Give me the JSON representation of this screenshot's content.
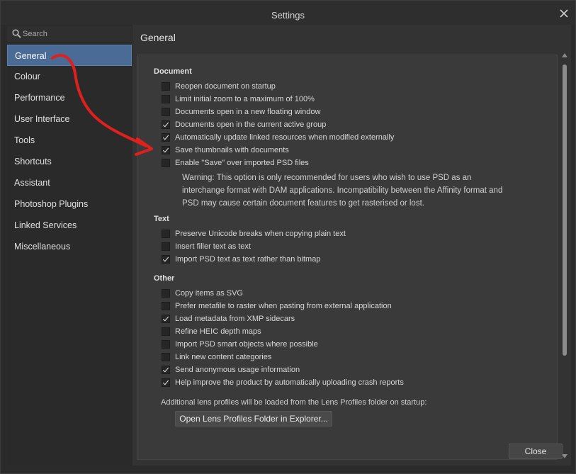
{
  "window": {
    "title": "Settings",
    "close_icon": "close-icon"
  },
  "sidebar": {
    "search_placeholder": "Search",
    "items": [
      {
        "label": "General",
        "active": true
      },
      {
        "label": "Colour"
      },
      {
        "label": "Performance"
      },
      {
        "label": "User Interface"
      },
      {
        "label": "Tools"
      },
      {
        "label": "Shortcuts"
      },
      {
        "label": "Assistant"
      },
      {
        "label": "Photoshop Plugins"
      },
      {
        "label": "Linked Services"
      },
      {
        "label": "Miscellaneous"
      }
    ]
  },
  "main": {
    "header": "General",
    "sections": {
      "document": {
        "title": "Document",
        "options": [
          {
            "label": "Reopen document on startup",
            "checked": false
          },
          {
            "label": "Limit initial zoom to a maximum of 100%",
            "checked": false
          },
          {
            "label": "Documents open in a new floating window",
            "checked": false
          },
          {
            "label": "Documents open in the current active group",
            "checked": true
          },
          {
            "label": "Automatically update linked resources when modified externally",
            "checked": true
          },
          {
            "label": "Save thumbnails with documents",
            "checked": true
          },
          {
            "label": "Enable \"Save\" over imported PSD files",
            "checked": false
          }
        ],
        "warning": "Warning: This option is only recommended for users who wish to use PSD as an interchange format with DAM applications. Incompatibility between the Affinity format and PSD may cause certain document features to get rasterised or lost."
      },
      "text": {
        "title": "Text",
        "options": [
          {
            "label": "Preserve Unicode breaks when copying plain text",
            "checked": false
          },
          {
            "label": "Insert filler text as text",
            "checked": false
          },
          {
            "label": "Import PSD text as text rather than bitmap",
            "checked": true
          }
        ]
      },
      "other": {
        "title": "Other",
        "options": [
          {
            "label": "Copy items as SVG",
            "checked": false
          },
          {
            "label": "Prefer metafile to raster when pasting from external application",
            "checked": false
          },
          {
            "label": "Load metadata from XMP sidecars",
            "checked": true
          },
          {
            "label": "Refine HEIC depth maps",
            "checked": false
          },
          {
            "label": "Import PSD smart objects where possible",
            "checked": false
          },
          {
            "label": "Link new content categories",
            "checked": false
          },
          {
            "label": "Send anonymous usage information",
            "checked": true
          },
          {
            "label": "Help improve the product by automatically uploading crash reports",
            "checked": true
          }
        ]
      }
    },
    "lens_note": "Additional lens profiles will be loaded from the Lens Profiles folder on startup:",
    "lens_button": "Open Lens Profiles Folder in Explorer..."
  },
  "footer": {
    "close_label": "Close"
  },
  "colors": {
    "accent": "#4a6b95",
    "annotation": "#e0201c"
  }
}
